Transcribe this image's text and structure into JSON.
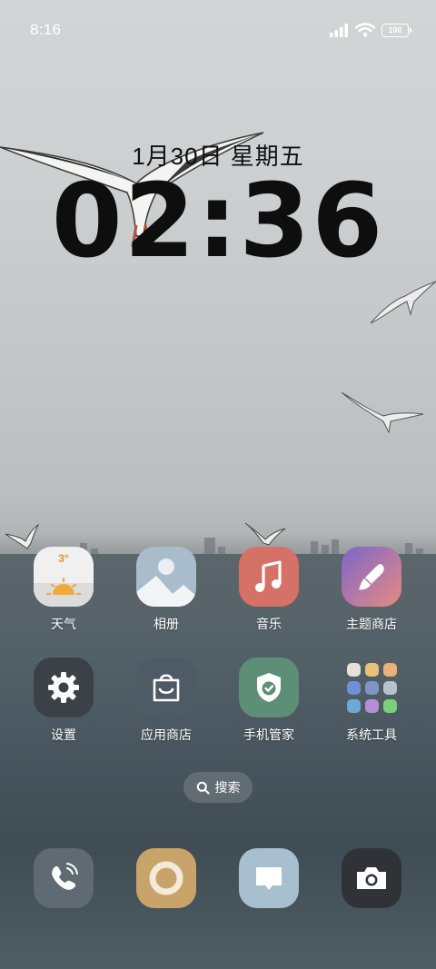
{
  "status_bar": {
    "time": "8:16",
    "battery": "100",
    "signal_icon": "signal-bars-icon",
    "wifi_icon": "wifi-icon"
  },
  "lock_clock": {
    "date": "1月30日 星期五",
    "time": "02:36"
  },
  "apps": [
    {
      "label": "天气",
      "icon": "weather-sun-icon",
      "temp": "3°"
    },
    {
      "label": "相册",
      "icon": "gallery-icon"
    },
    {
      "label": "音乐",
      "icon": "music-note-icon"
    },
    {
      "label": "主题商店",
      "icon": "theme-brush-icon"
    },
    {
      "label": "设置",
      "icon": "gear-icon"
    },
    {
      "label": "应用商店",
      "icon": "shopping-bag-icon"
    },
    {
      "label": "手机管家",
      "icon": "shield-check-icon"
    },
    {
      "label": "系统工具",
      "icon": "folder-icon"
    }
  ],
  "search": {
    "label": "搜索",
    "icon": "search-icon"
  },
  "dock": [
    {
      "name": "phone",
      "icon": "phone-icon"
    },
    {
      "name": "browser",
      "icon": "browser-ring-icon"
    },
    {
      "name": "messages",
      "icon": "message-bubble-icon"
    },
    {
      "name": "camera",
      "icon": "camera-icon"
    }
  ],
  "colors": {
    "weather": "#f0f0f0",
    "gallery": "#a9bccb",
    "music": "#d57167",
    "theme_from": "#7b66c8",
    "theme_to": "#e78a7e",
    "settings": "#3c4147",
    "app_store": "#4e5a66",
    "security": "#5d8e76",
    "phone": "#5f6a73",
    "browser": "#c9a46a",
    "messages": "#a8bfcf",
    "camera": "#2f3338"
  }
}
